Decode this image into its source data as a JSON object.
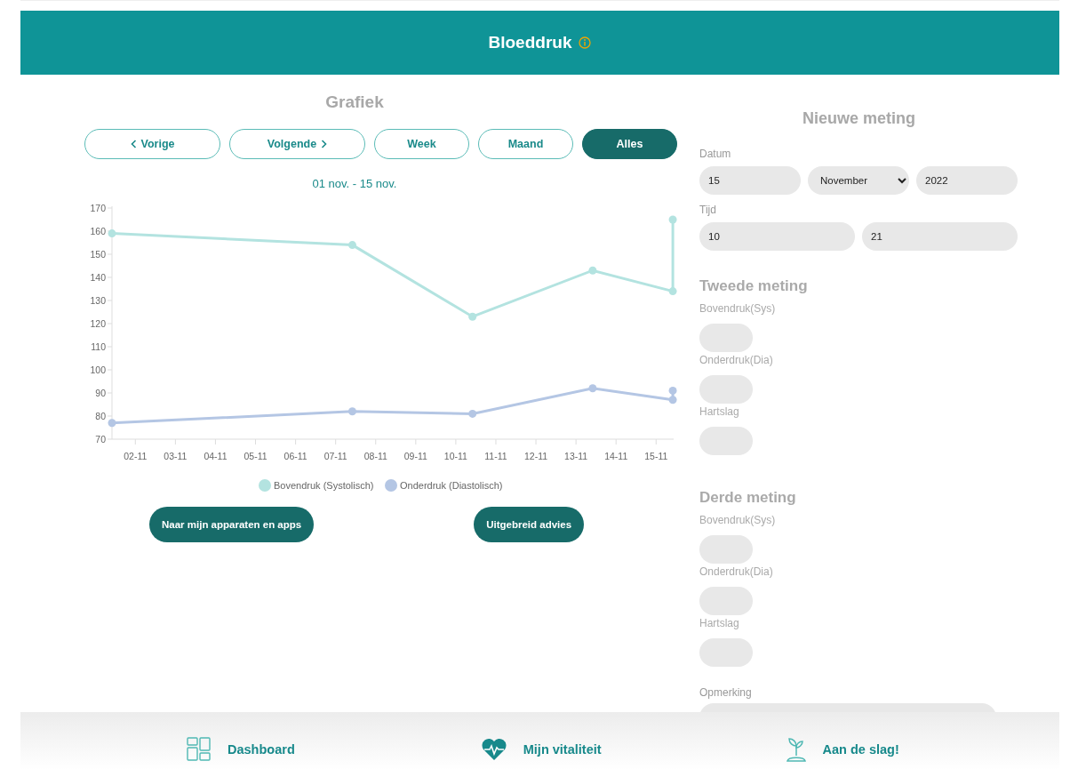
{
  "header": {
    "title": "Bloeddruk"
  },
  "chart_panel": {
    "title": "Grafiek",
    "nav_buttons": [
      {
        "label": "Vorige",
        "kind": "prev",
        "selected": false
      },
      {
        "label": "Volgende",
        "kind": "next",
        "selected": false
      },
      {
        "label": "Week",
        "kind": "period",
        "selected": false
      },
      {
        "label": "Maand",
        "kind": "period",
        "selected": false
      },
      {
        "label": "Alles",
        "kind": "period",
        "selected": true
      }
    ],
    "range": "01 nov. - 15 nov.",
    "chart_data": {
      "type": "line",
      "x": [
        "2022-11-01T10:00",
        "2022-11-07T10:00",
        "2022-11-10T10:00",
        "2022-11-13T10:00",
        "2022-11-15T10:00",
        "2022-11-15T10:00"
      ],
      "series": [
        {
          "name": "Bovendruk (Systolisch)",
          "color": "#b3e3e0",
          "marker": "circle",
          "values": [
            159,
            154,
            123,
            143,
            134,
            165
          ]
        },
        {
          "name": "Onderdruk (Diastolisch)",
          "color": "#b4c6e4",
          "marker": "circle",
          "values": [
            77,
            82,
            81,
            92,
            87,
            91
          ]
        }
      ],
      "legend": "bottom",
      "xlim": [
        "2022-11-01T10:00",
        "2022-11-15T10:30"
      ],
      "ylim": [
        70,
        170
      ],
      "yticks": [
        70,
        80,
        90,
        100,
        110,
        120,
        130,
        140,
        150,
        160,
        170
      ],
      "xticks": [
        {
          "value": "2022-11-02",
          "label": "02-11"
        },
        {
          "value": "2022-11-03",
          "label": "03-11"
        },
        {
          "value": "2022-11-04",
          "label": "04-11"
        },
        {
          "value": "2022-11-05",
          "label": "05-11"
        },
        {
          "value": "2022-11-06",
          "label": "06-11"
        },
        {
          "value": "2022-11-07",
          "label": "07-11"
        },
        {
          "value": "2022-11-08",
          "label": "08-11"
        },
        {
          "value": "2022-11-09",
          "label": "09-11"
        },
        {
          "value": "2022-11-10",
          "label": "10-11"
        },
        {
          "value": "2022-11-11",
          "label": "11-11"
        },
        {
          "value": "2022-11-12",
          "label": "12-11"
        },
        {
          "value": "2022-11-13",
          "label": "13-11"
        },
        {
          "value": "2022-11-14",
          "label": "14-11"
        },
        {
          "value": "2022-11-15",
          "label": "15-11"
        }
      ]
    },
    "actions": [
      "Naar mijn apparaten en apps",
      "Uitgebreid advies"
    ]
  },
  "form": {
    "title": "Nieuwe meting",
    "date": {
      "label": "Datum",
      "day": "15",
      "month": "November",
      "year": "2022"
    },
    "time": {
      "label": "Tijd",
      "hour": "10",
      "minute": "21"
    },
    "measurements": [
      {
        "title": "Tweede meting",
        "fields": [
          "Bovendruk(Sys)",
          "Onderdruk(Dia)",
          "Hartslag"
        ]
      },
      {
        "title": "Derde meting",
        "fields": [
          "Bovendruk(Sys)",
          "Onderdruk(Dia)",
          "Hartslag"
        ]
      }
    ],
    "remark": {
      "label": "Opmerking"
    }
  },
  "footer_nav": [
    {
      "label": "Dashboard",
      "kind": "dashboard"
    },
    {
      "label": "Mijn vitaliteit",
      "kind": "vitality"
    },
    {
      "label": "Aan de slag!",
      "kind": "start"
    }
  ]
}
